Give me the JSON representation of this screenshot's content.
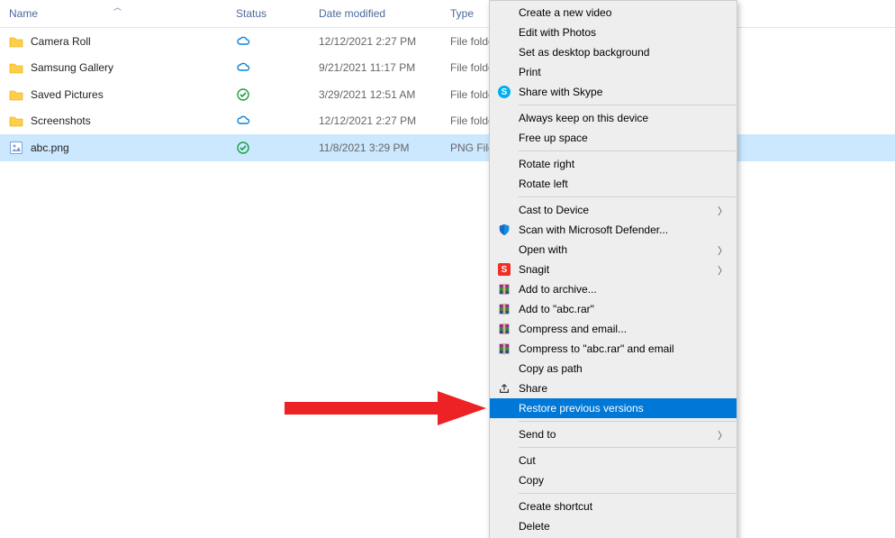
{
  "columns": {
    "name": "Name",
    "status": "Status",
    "date": "Date modified",
    "type": "Type"
  },
  "rows": [
    {
      "name": "Camera Roll",
      "icon": "folder",
      "status": "cloud",
      "date": "12/12/2021 2:27 PM",
      "type": "File folder"
    },
    {
      "name": "Samsung Gallery",
      "icon": "folder",
      "status": "cloud",
      "date": "9/21/2021 11:17 PM",
      "type": "File folder"
    },
    {
      "name": "Saved Pictures",
      "icon": "folder",
      "status": "check",
      "date": "3/29/2021 12:51 AM",
      "type": "File folder"
    },
    {
      "name": "Screenshots",
      "icon": "folder",
      "status": "cloud",
      "date": "12/12/2021 2:27 PM",
      "type": "File folder"
    },
    {
      "name": "abc.png",
      "icon": "image",
      "status": "check",
      "date": "11/8/2021 3:29 PM",
      "type": "PNG File",
      "selected": true
    }
  ],
  "menu": [
    {
      "label": "Create a new video"
    },
    {
      "label": "Edit with Photos"
    },
    {
      "label": "Set as desktop background"
    },
    {
      "label": "Print"
    },
    {
      "label": "Share with Skype",
      "icon": "skype"
    },
    {
      "sep": true
    },
    {
      "label": "Always keep on this device"
    },
    {
      "label": "Free up space"
    },
    {
      "sep": true
    },
    {
      "label": "Rotate right"
    },
    {
      "label": "Rotate left"
    },
    {
      "sep": true
    },
    {
      "label": "Cast to Device",
      "submenu": true
    },
    {
      "label": "Scan with Microsoft Defender...",
      "icon": "shield"
    },
    {
      "label": "Open with",
      "submenu": true
    },
    {
      "label": "Snagit",
      "icon": "snagit",
      "submenu": true
    },
    {
      "label": "Add to archive...",
      "icon": "rar"
    },
    {
      "label": "Add to \"abc.rar\"",
      "icon": "rar"
    },
    {
      "label": "Compress and email...",
      "icon": "rar"
    },
    {
      "label": "Compress to \"abc.rar\" and email",
      "icon": "rar"
    },
    {
      "label": "Copy as path"
    },
    {
      "label": "Share",
      "icon": "share"
    },
    {
      "label": "Restore previous versions",
      "highlight": true
    },
    {
      "sep": true
    },
    {
      "label": "Send to",
      "submenu": true
    },
    {
      "sep": true
    },
    {
      "label": "Cut"
    },
    {
      "label": "Copy"
    },
    {
      "sep": true
    },
    {
      "label": "Create shortcut"
    },
    {
      "label": "Delete"
    }
  ]
}
